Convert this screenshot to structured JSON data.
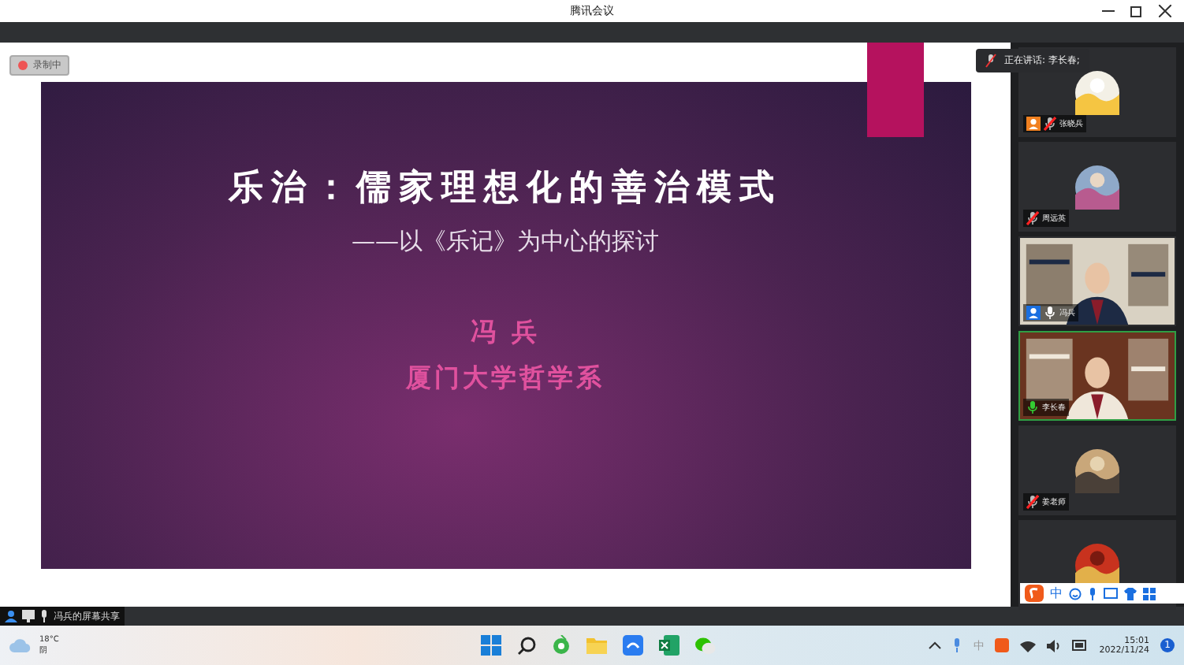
{
  "window": {
    "title": "腾讯会议"
  },
  "recording": {
    "label": "录制中"
  },
  "speaking": {
    "label": "正在讲话: 李长春;"
  },
  "slide": {
    "title": "乐治：儒家理想化的善治模式",
    "subtitle": "——以《乐记》为中心的探讨",
    "author": "冯 兵",
    "affiliation": "厦门大学哲学系"
  },
  "participants": [
    {
      "name": "张晓兵",
      "kind": "avatar",
      "host": true,
      "muted": true,
      "speaking": false
    },
    {
      "name": "周远英",
      "kind": "avatar",
      "host": false,
      "muted": true,
      "speaking": false
    },
    {
      "name": "冯兵",
      "kind": "video",
      "host": true,
      "muted": false,
      "speaking": false
    },
    {
      "name": "李长春",
      "kind": "video",
      "host": false,
      "muted": false,
      "speaking": true
    },
    {
      "name": "姜老师",
      "kind": "avatar",
      "host": false,
      "muted": true,
      "speaking": false
    },
    {
      "kind": "avatar",
      "speaking": false
    }
  ],
  "screen_share": {
    "label": "冯兵的屏幕共享"
  },
  "ime_toolbar": {
    "mode": "中"
  },
  "taskbar": {
    "temperature": "18°C",
    "condition": "阴",
    "ime": "中",
    "time": "15:01",
    "date": "2022/11/24",
    "notifications": "1"
  }
}
